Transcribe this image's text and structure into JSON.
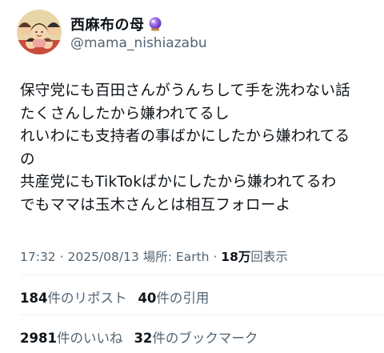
{
  "author": {
    "display_name": "西麻布の母",
    "handle": "@mama_nishiazabu",
    "badge_icon": "crystal-ball-icon"
  },
  "tweet": {
    "lines": [
      "保守党にも百田さんがうんちして手を洗わない話",
      "たくさんしたから嫌われてるし",
      "れいわにも支持者の事ばかにしたから嫌われてる",
      "の",
      "共産党にもTikTokばかにしたから嫌われてるわ",
      "でもママは玉木さんとは相互フォローよ"
    ]
  },
  "meta": {
    "time": "17:32",
    "date": "2025/08/13",
    "location_label": "場所: Earth",
    "views_count": "18万",
    "views_label": "回表示",
    "separator": "·"
  },
  "stats": {
    "reposts_count": "184",
    "reposts_label": "件のリポスト",
    "quotes_count": "40",
    "quotes_label": "件の引用",
    "likes_count": "2981",
    "likes_label": "件のいいね",
    "bookmarks_count": "32",
    "bookmarks_label": "件のブックマーク"
  },
  "colors": {
    "text_primary": "#0f1419",
    "text_secondary": "#536471",
    "divider": "#eff3f4",
    "badge_purple": "#7b4bd6"
  }
}
